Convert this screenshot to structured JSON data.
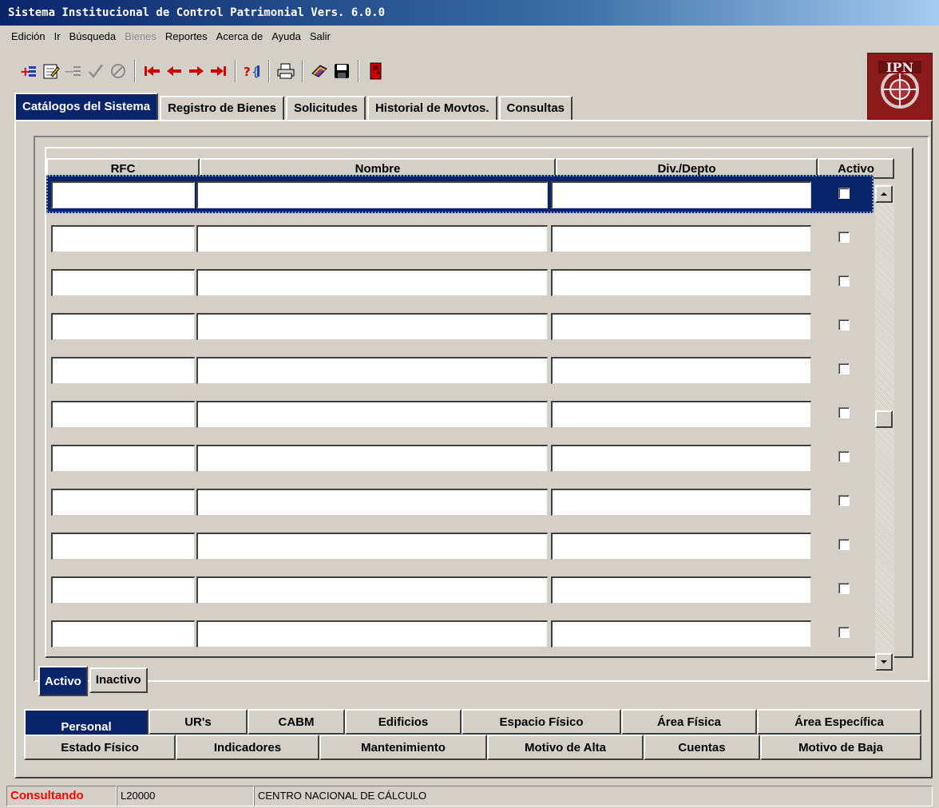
{
  "window": {
    "title": "Sistema Institucional de Control Patrimonial Vers. 6.0.0"
  },
  "menu": [
    {
      "label": "Edición",
      "disabled": false
    },
    {
      "label": "Ir",
      "disabled": false
    },
    {
      "label": "Búsqueda",
      "disabled": false
    },
    {
      "label": "Bienes",
      "disabled": true
    },
    {
      "label": "Reportes",
      "disabled": false
    },
    {
      "label": "Acerca de",
      "disabled": false
    },
    {
      "label": "Ayuda",
      "disabled": false
    },
    {
      "label": "Salir",
      "disabled": false
    }
  ],
  "toolbar": {
    "icons": [
      "insert-record-icon",
      "edit-record-icon",
      "delete-record-icon",
      "accept-icon",
      "cancel-icon",
      "first-record-icon",
      "previous-record-icon",
      "next-record-icon",
      "last-record-icon",
      "query-icon",
      "print-icon",
      "bookmark-icon",
      "save-icon",
      "exit-door-icon"
    ]
  },
  "logo": {
    "text": "IPN"
  },
  "main_tabs": [
    {
      "label": "Catálogos del Sistema",
      "active": true
    },
    {
      "label": "Registro de Bienes",
      "active": false
    },
    {
      "label": "Solicitudes",
      "active": false
    },
    {
      "label": "Historial de Movtos.",
      "active": false
    },
    {
      "label": "Consultas",
      "active": false
    }
  ],
  "grid": {
    "columns": [
      "RFC",
      "Nombre",
      "Div./Depto",
      "Activo"
    ],
    "rows": [
      {
        "rfc": "",
        "nombre": "",
        "depto": "",
        "activo": false,
        "selected": true
      },
      {
        "rfc": "",
        "nombre": "",
        "depto": "",
        "activo": false,
        "selected": false
      },
      {
        "rfc": "",
        "nombre": "",
        "depto": "",
        "activo": false,
        "selected": false
      },
      {
        "rfc": "",
        "nombre": "",
        "depto": "",
        "activo": false,
        "selected": false
      },
      {
        "rfc": "",
        "nombre": "",
        "depto": "",
        "activo": false,
        "selected": false
      },
      {
        "rfc": "",
        "nombre": "",
        "depto": "",
        "activo": false,
        "selected": false
      },
      {
        "rfc": "",
        "nombre": "",
        "depto": "",
        "activo": false,
        "selected": false
      },
      {
        "rfc": "",
        "nombre": "",
        "depto": "",
        "activo": false,
        "selected": false
      },
      {
        "rfc": "",
        "nombre": "",
        "depto": "",
        "activo": false,
        "selected": false
      },
      {
        "rfc": "",
        "nombre": "",
        "depto": "",
        "activo": false,
        "selected": false
      },
      {
        "rfc": "",
        "nombre": "",
        "depto": "",
        "activo": false,
        "selected": false
      }
    ]
  },
  "sub_tabs": [
    {
      "label": "Activo",
      "active": true
    },
    {
      "label": "Inactivo",
      "active": false
    }
  ],
  "catalog_tabs_row1": [
    {
      "label": "Personal",
      "active": true
    },
    {
      "label": "UR's",
      "active": false
    },
    {
      "label": "CABM",
      "active": false
    },
    {
      "label": "Edificios",
      "active": false
    },
    {
      "label": "Espacio Físico",
      "active": false
    },
    {
      "label": "Área Física",
      "active": false
    },
    {
      "label": "Área Específica",
      "active": false
    }
  ],
  "catalog_tabs_row2": [
    {
      "label": "Estado Físico",
      "active": false
    },
    {
      "label": "Indicadores",
      "active": false
    },
    {
      "label": "Mantenimiento",
      "active": false
    },
    {
      "label": "Motivo de Alta",
      "active": false
    },
    {
      "label": "Cuentas",
      "active": false
    },
    {
      "label": "Motivo de Baja",
      "active": false
    }
  ],
  "status": {
    "mode": "Consultando",
    "code": "L20000",
    "unit": "CENTRO NACIONAL DE CÁLCULO"
  },
  "colors": {
    "active_tab": "#0a246a",
    "mode_text": "#ff0000",
    "logo_bg": "#8b1a1a"
  }
}
